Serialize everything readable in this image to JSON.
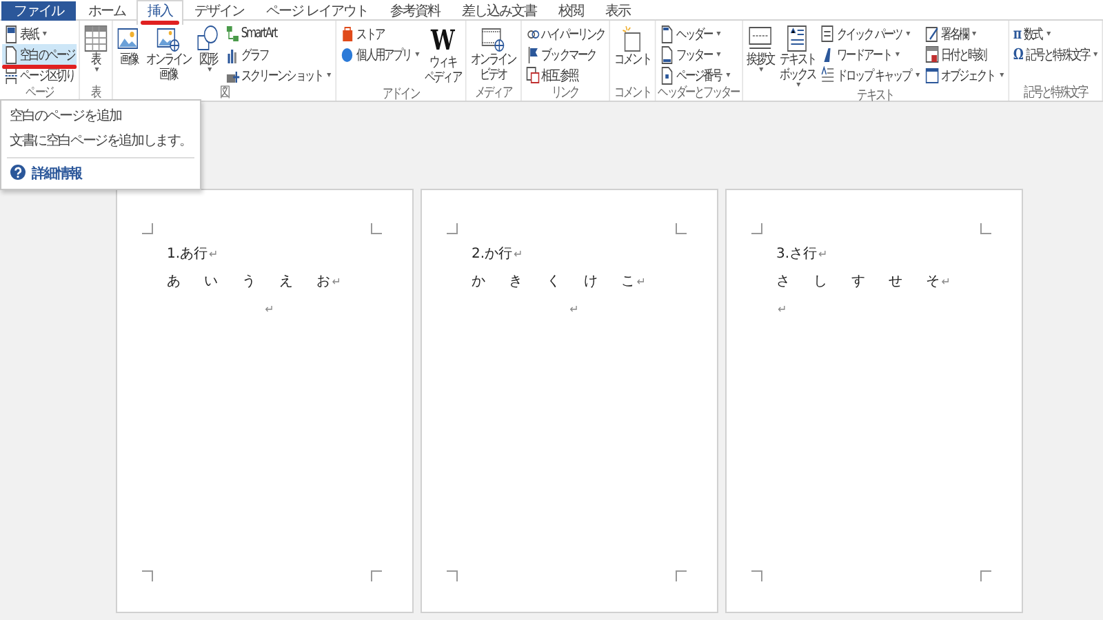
{
  "tabs": [
    {
      "label": "ファイル",
      "kind": "file",
      "selected": false,
      "annotated": false
    },
    {
      "label": "ホーム",
      "kind": "tab",
      "selected": false,
      "annotated": false
    },
    {
      "label": "挿入",
      "kind": "tab",
      "selected": true,
      "annotated": true
    },
    {
      "label": "デザイン",
      "kind": "tab",
      "selected": false,
      "annotated": false
    },
    {
      "label": "ページ レイアウト",
      "kind": "tab",
      "selected": false,
      "annotated": false
    },
    {
      "label": "参考資料",
      "kind": "tab",
      "selected": false,
      "annotated": false
    },
    {
      "label": "差し込み文書",
      "kind": "tab",
      "selected": false,
      "annotated": false
    },
    {
      "label": "校閲",
      "kind": "tab",
      "selected": false,
      "annotated": false
    },
    {
      "label": "表示",
      "kind": "tab",
      "selected": false,
      "annotated": false
    }
  ],
  "ribbon_groups": [
    {
      "label": "ページ",
      "items": [
        {
          "kind": "small",
          "lines": [
            "表紙"
          ],
          "dropdown": true
        },
        {
          "kind": "small",
          "lines": [
            "空白のページ"
          ],
          "dropdown": false,
          "highlighted": true,
          "annotated": true
        },
        {
          "kind": "small",
          "lines": [
            "ページ区切り"
          ],
          "dropdown": false
        }
      ]
    },
    {
      "label": "表",
      "items": [
        {
          "kind": "large",
          "lines": [
            "表"
          ],
          "dropdown": true
        }
      ]
    },
    {
      "label": "図",
      "items": [
        {
          "kind": "large",
          "lines": [
            "画像"
          ],
          "dropdown": false
        },
        {
          "kind": "large",
          "lines": [
            "オンライン",
            "画像"
          ],
          "dropdown": false
        },
        {
          "kind": "large",
          "lines": [
            "図形"
          ],
          "dropdown": true
        },
        {
          "kind": "small",
          "lines": [
            "SmartArt"
          ],
          "dropdown": false
        },
        {
          "kind": "small",
          "lines": [
            "グラフ"
          ],
          "dropdown": false
        },
        {
          "kind": "small",
          "lines": [
            "スクリーンショット"
          ],
          "dropdown": true
        }
      ]
    },
    {
      "label": "アドイン",
      "items": [
        {
          "kind": "small",
          "lines": [
            "ストア"
          ],
          "dropdown": false
        },
        {
          "kind": "small",
          "lines": [
            "個人用アプリ"
          ],
          "dropdown": true
        },
        {
          "kind": "large",
          "lines": [
            "ウィキ",
            "ペディア"
          ],
          "dropdown": false,
          "glyph": "W"
        }
      ]
    },
    {
      "label": "メディア",
      "items": [
        {
          "kind": "large",
          "lines": [
            "オンライン",
            "ビデオ"
          ],
          "dropdown": false
        }
      ]
    },
    {
      "label": "リンク",
      "items": [
        {
          "kind": "small",
          "lines": [
            "ハイパーリンク"
          ],
          "dropdown": false
        },
        {
          "kind": "small",
          "lines": [
            "ブックマーク"
          ],
          "dropdown": false
        },
        {
          "kind": "small",
          "lines": [
            "相互参照"
          ],
          "dropdown": false
        }
      ]
    },
    {
      "label": "コメント",
      "items": [
        {
          "kind": "large",
          "lines": [
            "コメント"
          ],
          "dropdown": false
        }
      ]
    },
    {
      "label": "ヘッダーとフッター",
      "items": [
        {
          "kind": "small",
          "lines": [
            "ヘッダー"
          ],
          "dropdown": true
        },
        {
          "kind": "small",
          "lines": [
            "フッター"
          ],
          "dropdown": true
        },
        {
          "kind": "small",
          "lines": [
            "ページ番号"
          ],
          "dropdown": true
        }
      ]
    },
    {
      "label": "テキスト",
      "items": [
        {
          "kind": "large",
          "lines": [
            "挨拶文"
          ],
          "dropdown": true
        },
        {
          "kind": "large",
          "lines": [
            "テキスト",
            "ボックス"
          ],
          "dropdown": true
        },
        {
          "kind": "small",
          "lines": [
            "クイック パーツ"
          ],
          "dropdown": true
        },
        {
          "kind": "small",
          "lines": [
            "ワードアート"
          ],
          "dropdown": true
        },
        {
          "kind": "small",
          "lines": [
            "ドロップ キャップ"
          ],
          "dropdown": true
        },
        {
          "kind": "small",
          "lines": [
            "署名欄"
          ],
          "dropdown": true
        },
        {
          "kind": "small",
          "lines": [
            "日付と時刻"
          ],
          "dropdown": false
        },
        {
          "kind": "small",
          "lines": [
            "オブジェクト"
          ],
          "dropdown": true
        }
      ]
    },
    {
      "label": "記号と特殊文字",
      "items": [
        {
          "kind": "small",
          "lines": [
            "数式"
          ],
          "dropdown": true,
          "glyph": "π"
        },
        {
          "kind": "small",
          "lines": [
            "記号と特殊文字"
          ],
          "dropdown": true,
          "glyph": "Ω"
        }
      ]
    }
  ],
  "tooltip": {
    "title": "空白のページを追加",
    "description": "文書に空白ページを追加します。",
    "link": "詳細情報"
  },
  "pages": [
    {
      "paragraphs": [
        {
          "text": "1.あ行",
          "mark": "↵",
          "centered": false
        },
        {
          "text": "あ い う え お",
          "mark": "↵",
          "centered": false
        },
        {
          "mark": "↵",
          "centered": true
        }
      ]
    },
    {
      "paragraphs": [
        {
          "text": "2.か行",
          "mark": "↵",
          "centered": false
        },
        {
          "text": "か き く け こ",
          "mark": "↵",
          "centered": false
        },
        {
          "mark": "↵",
          "centered": true
        }
      ]
    },
    {
      "paragraphs": [
        {
          "text": "3.さ行",
          "mark": "↵",
          "centered": false
        },
        {
          "text": "さ し す せ そ",
          "mark": "↵",
          "centered": false
        },
        {
          "mark": "↵",
          "centered": false
        }
      ]
    }
  ]
}
